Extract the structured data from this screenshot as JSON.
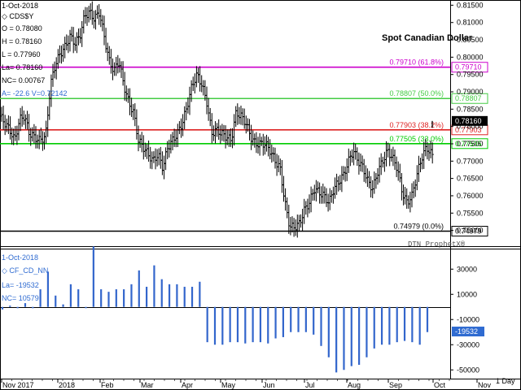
{
  "chart_data": [
    {
      "type": "ohlc",
      "title": "Spot Canadian Dollar",
      "date": "1-Oct-2018",
      "symbol": "CDS$Y",
      "open": "O = 0.78080",
      "high": "H = 0.78160",
      "low": "L = 0.77960",
      "last": "La= 0.78160",
      "net_change": "NC= 0.00767",
      "indicator": "A= -22.6 V=0.72142",
      "ylim": [
        0.7485,
        0.8165
      ],
      "y_ticks": [
        0.815,
        0.81,
        0.805,
        0.8,
        0.795,
        0.79,
        0.785,
        0.78,
        0.775,
        0.77,
        0.765,
        0.76,
        0.755,
        0.75
      ],
      "y_tick_labels": [
        "0.81500",
        "0.81000",
        "0.80500",
        "0.80000",
        "0.79500",
        "0.79000",
        "0.78500",
        "0.78000",
        "0.77500",
        "0.77000",
        "0.76500",
        "0.76000",
        "0.75500",
        "0.75000"
      ],
      "last_price_label": "0.78160",
      "hlines": [
        {
          "value": 0.7971,
          "color": "#cc00cc",
          "label": "0.79710 (61.8%)",
          "tag": "0.79710"
        },
        {
          "value": 0.78807,
          "color": "#44cc44",
          "label": "0.78807 (50.0%)",
          "tag": "0.78807"
        },
        {
          "value": 0.77903,
          "color": "#dd2222",
          "label": "0.77903 (38.2%)",
          "tag": "0.77903"
        },
        {
          "value": 0.77505,
          "color": "#00cc00",
          "label": "0.77505 (33.0%)",
          "tag": "0.77505"
        },
        {
          "value": 0.74979,
          "color": "#000000",
          "label": "0.74979 (0.0%)",
          "tag": "0.74979"
        }
      ],
      "x_categories": [
        "Nov 2017",
        "2018",
        "Feb",
        "Mar",
        "Apr",
        "May",
        "Jun",
        "Jul",
        "Aug",
        "Sep",
        "Oct",
        "Nov"
      ],
      "period": "1 Day",
      "credit": "DTN ProphetX®",
      "series": [
        {
          "anchors": [
            [
              0,
              0.783
            ],
            [
              6,
              0.781
            ],
            [
              12,
              0.779
            ],
            [
              18,
              0.776
            ],
            [
              24,
              0.782
            ],
            [
              30,
              0.783
            ],
            [
              36,
              0.778
            ],
            [
              42,
              0.777
            ],
            [
              48,
              0.776
            ],
            [
              56,
              0.777
            ],
            [
              62,
              0.792
            ],
            [
              68,
              0.798
            ],
            [
              74,
              0.801
            ],
            [
              80,
              0.803
            ],
            [
              86,
              0.806
            ],
            [
              92,
              0.804
            ],
            [
              98,
              0.806
            ],
            [
              104,
              0.812
            ],
            [
              110,
              0.813
            ],
            [
              116,
              0.811
            ],
            [
              122,
              0.813
            ],
            [
              128,
              0.806
            ],
            [
              134,
              0.799
            ],
            [
              140,
              0.796
            ],
            [
              146,
              0.799
            ],
            [
              152,
              0.792
            ],
            [
              158,
              0.787
            ],
            [
              164,
              0.784
            ],
            [
              170,
              0.776
            ],
            [
              176,
              0.774
            ],
            [
              182,
              0.772
            ],
            [
              188,
              0.77
            ],
            [
              194,
              0.772
            ],
            [
              200,
              0.768
            ],
            [
              206,
              0.774
            ],
            [
              212,
              0.776
            ],
            [
              218,
              0.778
            ],
            [
              224,
              0.781
            ],
            [
              230,
              0.786
            ],
            [
              236,
              0.792
            ],
            [
              242,
              0.795
            ],
            [
              248,
              0.792
            ],
            [
              254,
              0.787
            ],
            [
              260,
              0.778
            ],
            [
              266,
              0.779
            ],
            [
              272,
              0.778
            ],
            [
              278,
              0.777
            ],
            [
              284,
              0.776
            ],
            [
              290,
              0.784
            ],
            [
              296,
              0.783
            ],
            [
              302,
              0.781
            ],
            [
              308,
              0.777
            ],
            [
              314,
              0.775
            ],
            [
              320,
              0.775
            ],
            [
              326,
              0.775
            ],
            [
              332,
              0.773
            ],
            [
              338,
              0.77
            ],
            [
              344,
              0.768
            ],
            [
              350,
              0.758
            ],
            [
              356,
              0.751
            ],
            [
              362,
              0.751
            ],
            [
              368,
              0.752
            ],
            [
              374,
              0.756
            ],
            [
              380,
              0.758
            ],
            [
              386,
              0.762
            ],
            [
              392,
              0.761
            ],
            [
              398,
              0.76
            ],
            [
              404,
              0.758
            ],
            [
              410,
              0.762
            ],
            [
              416,
              0.764
            ],
            [
              422,
              0.766
            ],
            [
              428,
              0.77
            ],
            [
              434,
              0.773
            ],
            [
              440,
              0.77
            ],
            [
              446,
              0.768
            ],
            [
              452,
              0.764
            ],
            [
              458,
              0.762
            ],
            [
              464,
              0.767
            ],
            [
              470,
              0.77
            ],
            [
              476,
              0.773
            ],
            [
              482,
              0.771
            ],
            [
              488,
              0.768
            ],
            [
              494,
              0.761
            ],
            [
              500,
              0.758
            ],
            [
              506,
              0.76
            ],
            [
              512,
              0.766
            ],
            [
              518,
              0.771
            ],
            [
              524,
              0.774
            ],
            [
              530,
              0.772
            ],
            [
              536,
              0.77
            ],
            [
              542,
              0.765
            ],
            [
              548,
              0.767
            ],
            [
              554,
              0.772
            ],
            [
              558,
              0.775
            ],
            [
              562,
              0.776
            ],
            [
              566,
              0.773
            ],
            [
              570,
              0.769
            ],
            [
              574,
              0.776
            ],
            [
              578,
              0.7785
            ]
          ]
        }
      ]
    },
    {
      "type": "bar",
      "date": "1-Oct-2018",
      "symbol": "CF_CD_NN",
      "last": "La= -19532",
      "net_change": "NC= 10579",
      "ylim": [
        -55000,
        45000
      ],
      "y_ticks": [
        30000,
        10000,
        -10000,
        -30000,
        -50000
      ],
      "y_tick_labels": [
        "30000",
        "10000",
        "-10000",
        "-30000",
        "-50000"
      ],
      "last_value_label": "-19532",
      "series": [
        {
          "name": "CF_CD_NN",
          "values": [
            -2000,
            1000,
            -1000,
            3000,
            -1000,
            14000,
            28000,
            9000,
            2000,
            18000,
            14000,
            -1000,
            48000,
            14000,
            12000,
            14000,
            14000,
            18000,
            29000,
            16000,
            33000,
            22000,
            18000,
            18000,
            16000,
            16000,
            20000,
            -28000,
            -30000,
            -30000,
            -28000,
            -28000,
            -29000,
            -28000,
            -28000,
            -29000,
            -25000,
            -24000,
            -20000,
            -20000,
            -20000,
            -22000,
            -31000,
            -40000,
            -52000,
            -50000,
            -47000,
            -46000,
            -40000,
            -33000,
            -30000,
            -30000,
            -28000,
            -27000,
            -28000,
            -30000,
            -20000
          ]
        }
      ]
    }
  ]
}
